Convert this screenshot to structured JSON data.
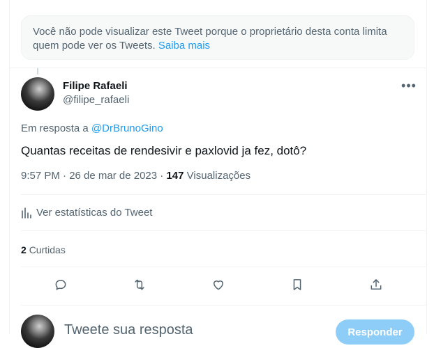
{
  "notice": {
    "text": "Você não pode visualizar este Tweet porque o proprietário desta conta limita quem pode ver os Tweets.",
    "link": "Saiba mais"
  },
  "tweet": {
    "author_name": "Filipe Rafaeli",
    "author_handle": "@filipe_rafaeli",
    "more_icon": "more-horizontal-icon",
    "reply_prefix": "Em resposta a",
    "reply_handle": "@DrBrunoGino",
    "text": "Quantas receitas de rendesivir e paxlovid ja fez, dotô?",
    "timestamp": "9:57 PM · 26 de mar de 2023 · ",
    "views_count": "147",
    "views_label": "Visualizações",
    "stats_label": "Ver estatísticas do Tweet",
    "retweets_count": "2",
    "retweets_label": "Curtidas"
  },
  "actions": {
    "icons": [
      "reply-icon",
      "retweet-icon",
      "like-icon",
      "bookmark-icon",
      "share-icon"
    ]
  },
  "composer": {
    "placeholder": "Tweete sua resposta",
    "button_label": "Responder"
  },
  "colors": {
    "accent": "#1d9bf0",
    "muted_text": "#536471",
    "disabled_button": "#8ecdf8"
  }
}
